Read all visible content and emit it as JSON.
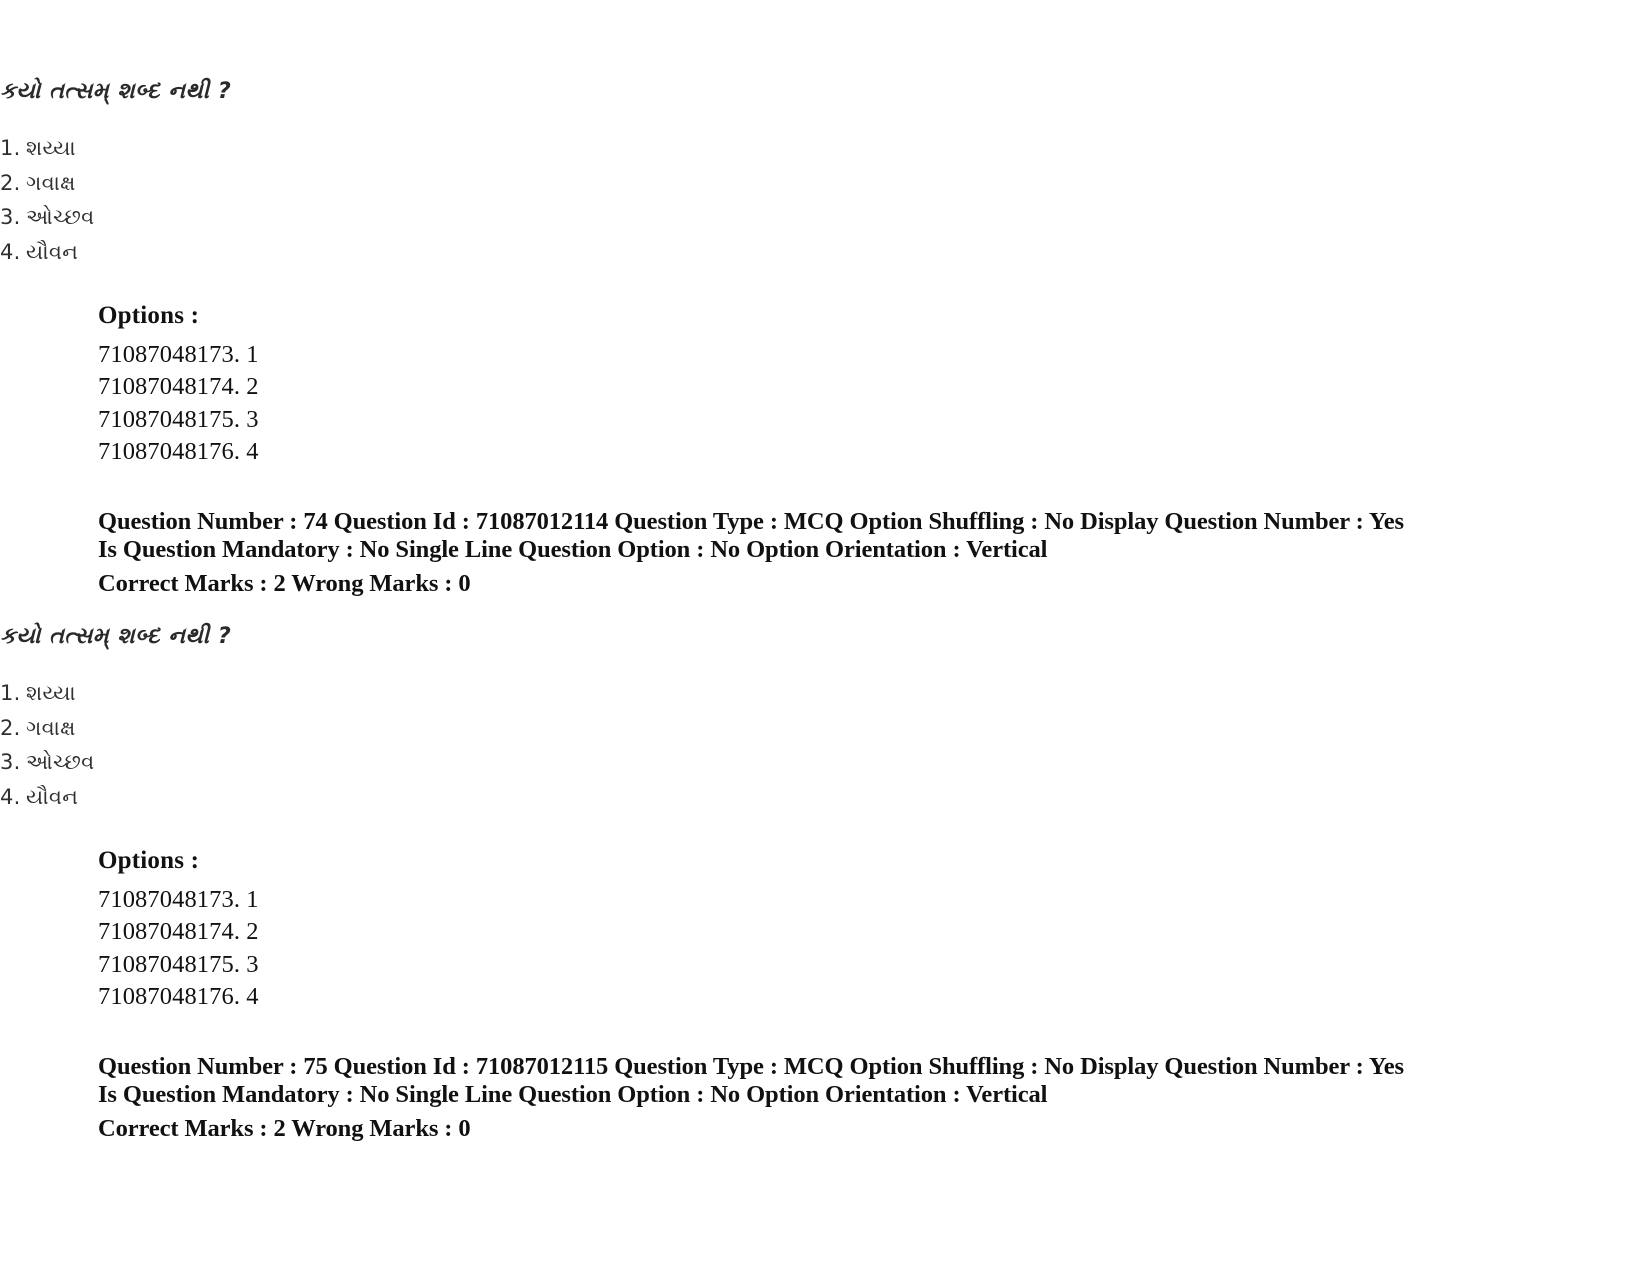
{
  "document": {
    "type": "exam-question-paper",
    "background_color": "#ffffff",
    "text_color": "#111111"
  },
  "blocks": [
    {
      "question_image": {
        "stem": "કયો તત્સમ્ શબ્દ નથી ?",
        "choices": [
          {
            "number": "1.",
            "text": "શય્યા"
          },
          {
            "number": "2.",
            "text": "ગવાક્ષ"
          },
          {
            "number": "3.",
            "text": "ઓચ્છવ"
          },
          {
            "number": "4.",
            "text": "યૌવન"
          }
        ]
      },
      "options_heading": "Options :",
      "options": [
        "71087048173. 1",
        "71087048174. 2",
        "71087048175. 3",
        "71087048176. 4"
      ],
      "meta_line_1": "Question Number : 74 Question Id : 71087012114 Question Type : MCQ Option Shuffling : No Display Question Number : Yes Is Question Mandatory : No Single Line Question Option : No Option Orientation : Vertical",
      "meta_line_2": "Correct Marks : 2 Wrong Marks : 0"
    },
    {
      "question_image": {
        "stem": "કયો તત્સમ્ શબ્દ નથી ?",
        "choices": [
          {
            "number": "1.",
            "text": "શય્યા"
          },
          {
            "number": "2.",
            "text": "ગવાક્ષ"
          },
          {
            "number": "3.",
            "text": "ઓચ્છવ"
          },
          {
            "number": "4.",
            "text": "યૌવન"
          }
        ]
      },
      "options_heading": "Options :",
      "options": [
        "71087048173. 1",
        "71087048174. 2",
        "71087048175. 3",
        "71087048176. 4"
      ],
      "meta_line_1": "Question Number : 75 Question Id : 71087012115 Question Type : MCQ Option Shuffling : No Display Question Number : Yes Is Question Mandatory : No Single Line Question Option : No Option Orientation : Vertical",
      "meta_line_2": "Correct Marks : 2 Wrong Marks : 0"
    }
  ]
}
